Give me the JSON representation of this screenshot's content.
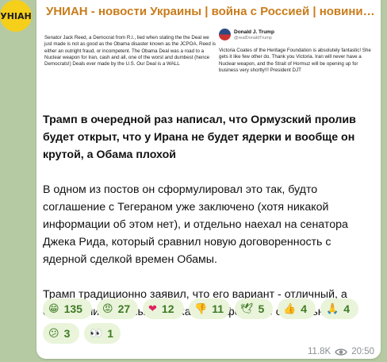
{
  "channel": {
    "avatar_text": "УНІАН",
    "title": "УНИАН - новости Украины | война с Россией | новини Україні..."
  },
  "image": {
    "left_text": "Senator Jack Reed, a Democrat from R.I., lied when stating the the Deal we just made is not as good as the Obama disaster known as the JCPOA. Reed is either an outright fraud, or incompetent. The Obama Deal was a road to a Nuclear weapon for Iran, cash and all, one of the worst and dumbest (hence Democrats!) Deals ever made by the U.S. Our Deal is a WALL",
    "tweet_name": "Donald J. Trump",
    "tweet_handle": "@realDonaldTrump",
    "tweet_text": "Victoria Coates of the Heritage Foundation is absolutely fantastic! She gets it like few other do. Thank you Victoria. Iran will never have a Nuclear weapon, and the Strait of Hormuz will be opening up for business very shortly!!! President DJT"
  },
  "post": {
    "headline": "Трамп в очередной раз написал, что Ормузский пролив будет открыт, что у Ирана не будет ядерки и вообще он крутой, а Обама плохой",
    "paragraph1": "В одном из постов он сформулировал это так, будто соглашение с Тегераном уже заключено (хотя никакой информации об этом нет), и отдельно наехал на сенатора Джека Рида, который сравнил новую договоренность с ядерной сделкой времен Обамы.",
    "paragraph2": "Трамп традиционно заявил, что его вариант - отличный, а соглашение Обамы было катастрофой. Всё стабильно."
  },
  "reactions": [
    {
      "icon": "laughing-face-icon",
      "emoji": "😁",
      "count": "135"
    },
    {
      "icon": "angry-face-icon",
      "emoji": "😡",
      "count": "27"
    },
    {
      "icon": "red-heart-icon",
      "emoji": "❤",
      "count": "12"
    },
    {
      "icon": "thumbs-down-icon",
      "emoji": "👎",
      "count": "11"
    },
    {
      "icon": "dove-icon",
      "emoji": "🕊",
      "count": "5"
    },
    {
      "icon": "thumbs-up-icon",
      "emoji": "👍",
      "count": "4"
    },
    {
      "icon": "folded-hands-icon",
      "emoji": "🙏",
      "count": "4"
    },
    {
      "icon": "confused-face-icon",
      "emoji": "😕",
      "count": "3"
    },
    {
      "icon": "eyes-icon",
      "emoji": "👀",
      "count": "1"
    }
  ],
  "meta": {
    "views": "11.8K",
    "time": "20:50"
  },
  "colors": {
    "background": "#b5c9a3",
    "channel_title": "#c97c1a",
    "reaction_bg": "#e9f4da",
    "reaction_text": "#3f7a25",
    "avatar": "#f6cf1b"
  }
}
